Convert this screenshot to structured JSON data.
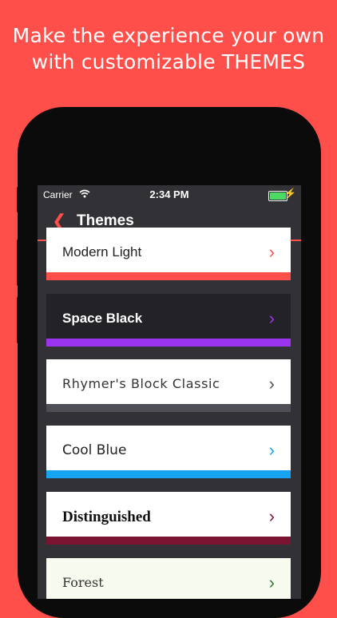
{
  "promo": {
    "line1": "Make the experience your own",
    "line2": "with customizable THEMES"
  },
  "status_bar": {
    "carrier": "Carrier",
    "time": "2:34 PM"
  },
  "nav": {
    "back_icon": "chevron-left-icon",
    "title": "Themes"
  },
  "themes": [
    {
      "name": "Modern Light",
      "card_bg": "#ffffff",
      "text_color": "#222222",
      "chevron_color": "#ff4f4b",
      "bar_color": "#ff4f4b"
    },
    {
      "name": "Space Black",
      "card_bg": "#222227",
      "text_color": "#ffffff",
      "chevron_color": "#9b34ef",
      "bar_color": "#9b34ef"
    },
    {
      "name": "Rhymer's Block Classic",
      "card_bg": "#ffffff",
      "text_color": "#333333",
      "chevron_color": "#555555",
      "bar_color": "#4e4e57"
    },
    {
      "name": "Cool Blue",
      "card_bg": "#ffffff",
      "text_color": "#222222",
      "chevron_color": "#16a4f2",
      "bar_color": "#16a4f2"
    },
    {
      "name": "Distinguished",
      "card_bg": "#ffffff",
      "text_color": "#111111",
      "chevron_color": "#7a1430",
      "bar_color": "#7a1430"
    },
    {
      "name": "Forest",
      "card_bg": "#f7faef",
      "text_color": "#333333",
      "chevron_color": "#2e7d32",
      "bar_color": "#2e7d32"
    }
  ],
  "colors": {
    "accent": "#ff4f4b",
    "screen_bg": "#323236"
  }
}
